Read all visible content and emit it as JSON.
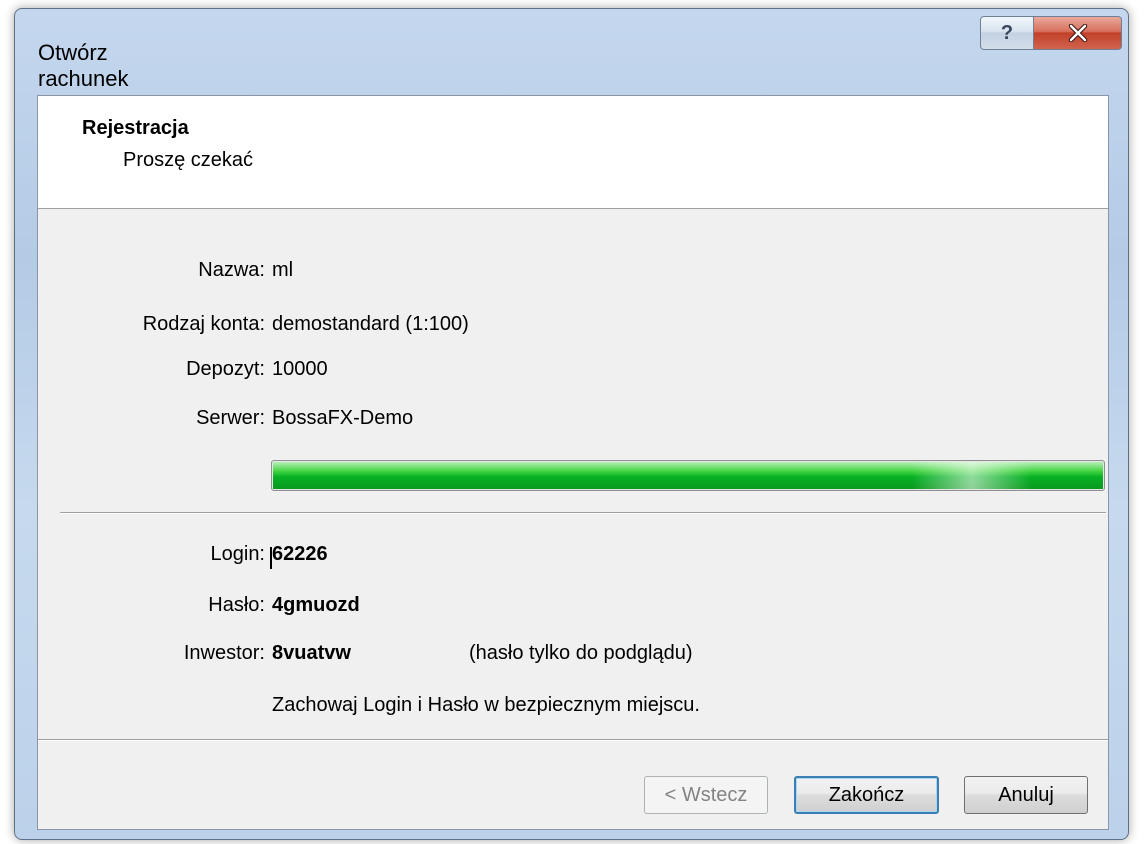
{
  "window": {
    "title": "Otwórz rachunek",
    "help_button": "?"
  },
  "header": {
    "title": "Rejestracja",
    "subtitle": "Proszę czekać"
  },
  "account": {
    "name_label": "Nazwa:",
    "name_value": "ml",
    "type_label": "Rodzaj konta:",
    "type_value": "demostandard (1:100)",
    "deposit_label": "Depozyt:",
    "deposit_value": "10000",
    "server_label": "Serwer:",
    "server_value": "BossaFX-Demo"
  },
  "progress": {
    "fraction": 1.0,
    "color": "#06b025"
  },
  "credentials": {
    "login_label": "Login:",
    "login_value": "62226",
    "password_label": "Hasło:",
    "password_value": "4gmuozd",
    "investor_label": "Inwestor:",
    "investor_value": "8vuatvw",
    "investor_hint": "(hasło tylko do podglądu)",
    "note": "Zachowaj Login i Hasło w bezpiecznym miejscu."
  },
  "buttons": {
    "back": "< Wstecz",
    "finish": "Zakończ",
    "cancel": "Anuluj"
  }
}
